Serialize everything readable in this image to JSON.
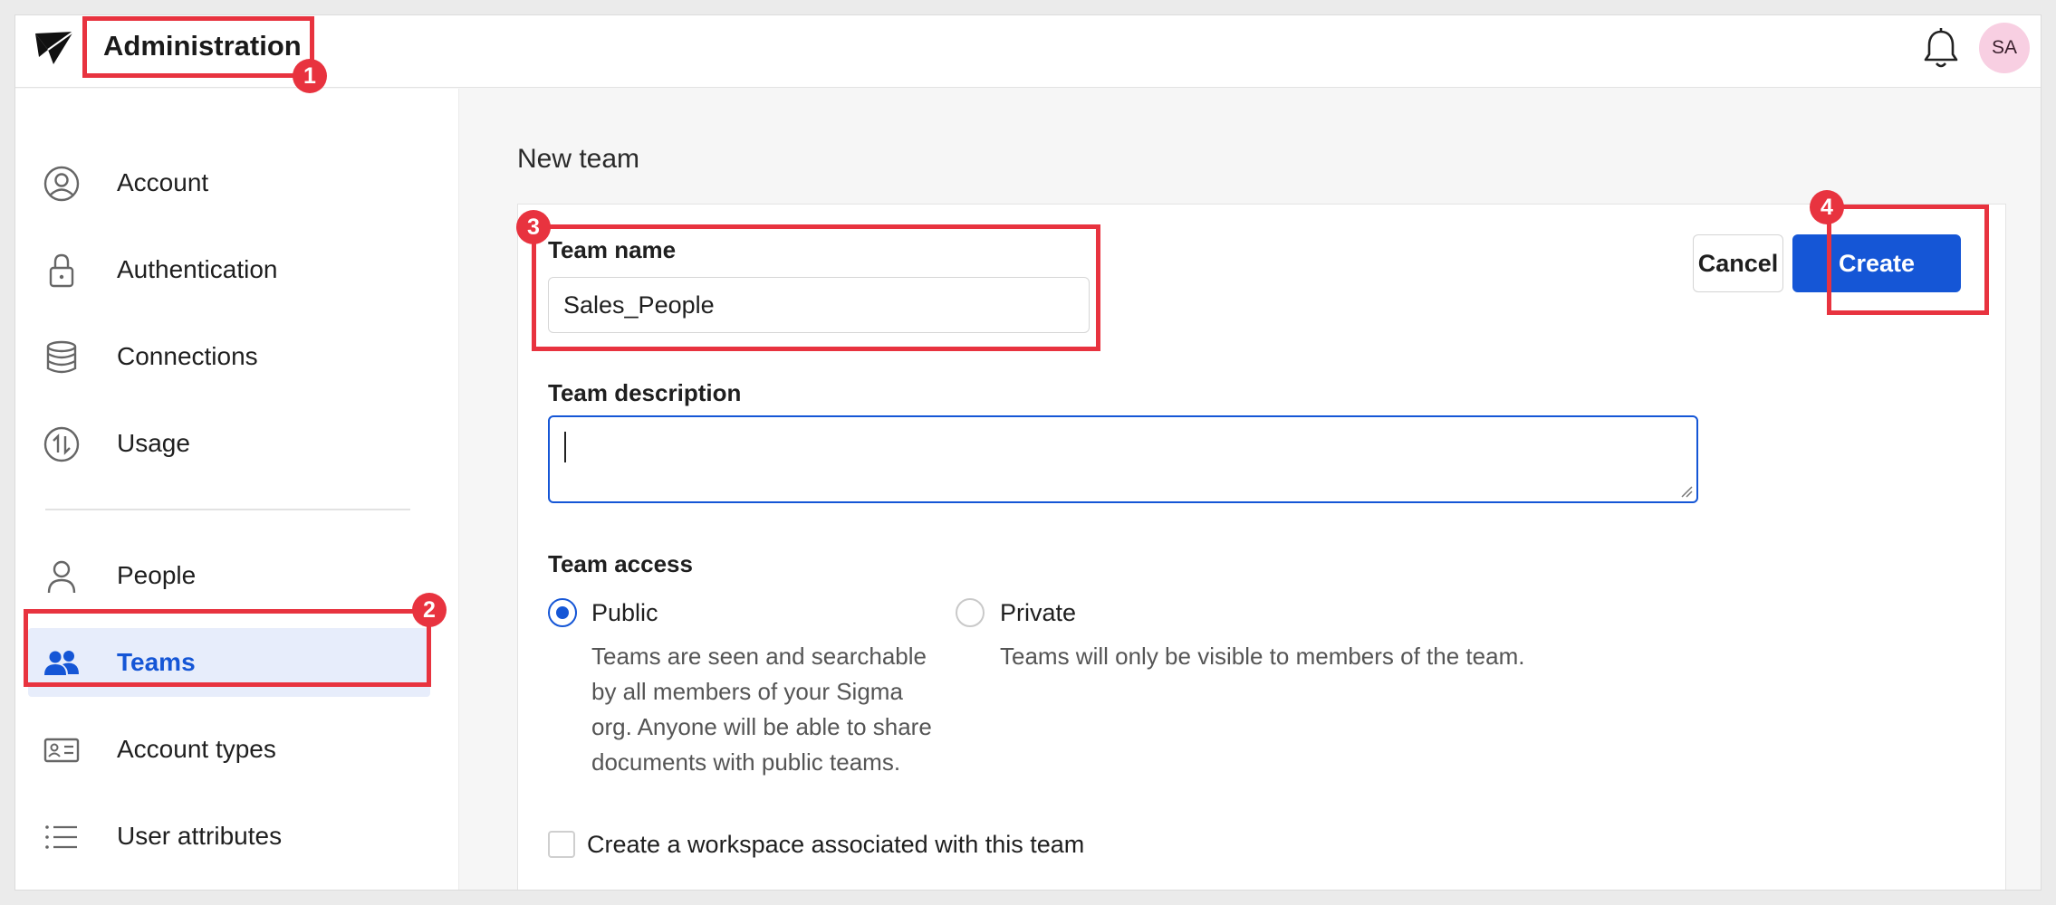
{
  "header": {
    "title": "Administration",
    "avatar_initials": "SA"
  },
  "sidebar": {
    "items": [
      {
        "label": "Account",
        "icon": "user-circle-icon"
      },
      {
        "label": "Authentication",
        "icon": "lock-icon"
      },
      {
        "label": "Connections",
        "icon": "database-icon"
      },
      {
        "label": "Usage",
        "icon": "usage-arrows-icon"
      },
      {
        "label": "People",
        "icon": "person-icon"
      },
      {
        "label": "Teams",
        "icon": "team-icon",
        "active": true
      },
      {
        "label": "Account types",
        "icon": "id-card-icon"
      },
      {
        "label": "User attributes",
        "icon": "list-icon"
      }
    ]
  },
  "main": {
    "page_title": "New team",
    "team_name_label": "Team name",
    "team_name_value": "Sales_People",
    "team_description_label": "Team description",
    "team_description_value": "",
    "team_access_label": "Team access",
    "public_label": "Public",
    "public_desc": "Teams are seen and searchable by all members of your Sigma org. Anyone will be able to share documents with public teams.",
    "private_label": "Private",
    "private_desc": "Teams will only be visible to members of the team.",
    "selected_access": "Public",
    "workspace_checkbox_label": "Create a workspace associated with this team",
    "workspace_checked": false,
    "cancel_label": "Cancel",
    "create_label": "Create"
  },
  "annotations": {
    "markers": [
      "1",
      "2",
      "3",
      "4"
    ]
  },
  "colors": {
    "accent": "#1556d6",
    "annotation_red": "#e8333f",
    "avatar_bg": "#f8cfe2",
    "active_nav_bg": "#e7edfb"
  }
}
